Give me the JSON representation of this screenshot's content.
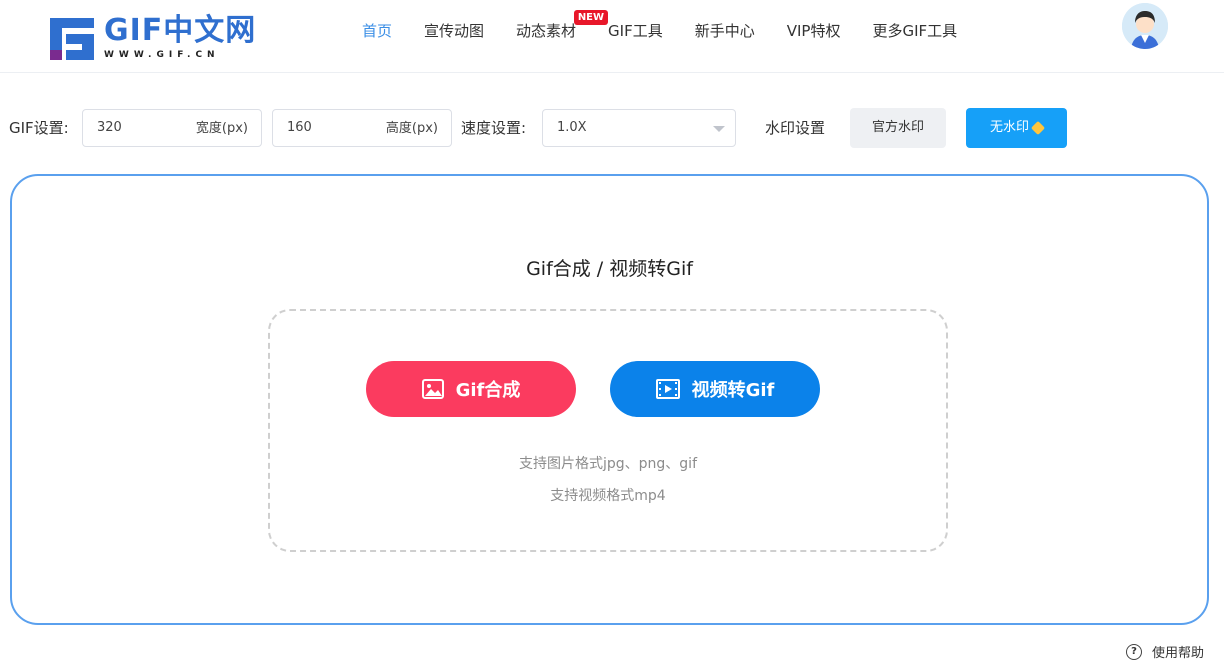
{
  "brand": {
    "title": "GIF中文网",
    "subtitle": "WWW.GIF.CN",
    "primary_color": "#2f6fcf",
    "accent_color": "#7a2b8f"
  },
  "nav": {
    "items": [
      {
        "label": "首页",
        "active": true
      },
      {
        "label": "宣传动图"
      },
      {
        "label": "动态素材",
        "badge": "NEW"
      },
      {
        "label": "GIF工具"
      },
      {
        "label": "新手中心"
      },
      {
        "label": "VIP特权"
      },
      {
        "label": "更多GIF工具"
      }
    ],
    "active_color": "#3a8ee6"
  },
  "settings": {
    "gif_label": "GIF设置:",
    "width_value": "320",
    "width_suffix": "宽度(px)",
    "height_value": "160",
    "height_suffix": "高度(px)",
    "speed_label": "速度设置:",
    "speed_value": "1.0X",
    "watermark_label": "水印设置",
    "official_watermark": "官方水印",
    "no_watermark": "无水印"
  },
  "main": {
    "title": "Gif合成 / 视频转Gif",
    "gif_button": "Gif合成",
    "video_button": "视频转Gif",
    "hint_images": "支持图片格式jpg、png、gif",
    "hint_video": "支持视频格式mp4",
    "gif_button_color": "#fb3b5f",
    "video_button_color": "#0b82ea"
  },
  "footer": {
    "help": "使用帮助"
  }
}
